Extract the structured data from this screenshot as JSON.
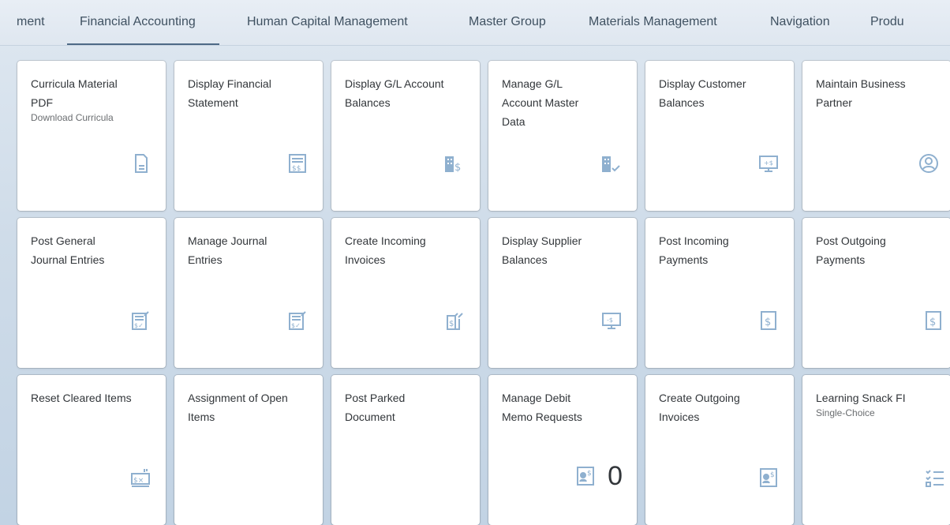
{
  "tabs": [
    {
      "label": "ment"
    },
    {
      "label": "Financial Accounting"
    },
    {
      "label": "Human Capital Management"
    },
    {
      "label": "Master Group"
    },
    {
      "label": "Materials Management"
    },
    {
      "label": "Navigation"
    },
    {
      "label": "Produ"
    }
  ],
  "active_tab": "Financial Accounting",
  "accent_color": "#4e6a86",
  "icon_color": "#8fb0cf",
  "tiles": [
    {
      "title": "Curricula Material\nPDF",
      "subtitle": "Download Curricula",
      "icon": "document-icon"
    },
    {
      "title": "Display Financial\nStatement",
      "icon": "financial-statement-icon"
    },
    {
      "title": "Display G/L Account\nBalances",
      "icon": "building-dollar-icon"
    },
    {
      "title": "Manage G/L\nAccount Master\nData",
      "icon": "building-check-icon"
    },
    {
      "title": "Display Customer\nBalances",
      "icon": "monitor-plus-dollar-icon"
    },
    {
      "title": "Maintain Business\nPartner",
      "icon": "person-circle-icon"
    },
    {
      "title": "Post General\nJournal Entries",
      "icon": "journal-edit-icon"
    },
    {
      "title": "Manage Journal\nEntries",
      "icon": "journal-edit-icon"
    },
    {
      "title": "Create Incoming\nInvoices",
      "icon": "invoice-edit-icon"
    },
    {
      "title": "Display Supplier\nBalances",
      "icon": "monitor-minus-dollar-icon"
    },
    {
      "title": "Post Incoming\nPayments",
      "icon": "dollar-box-icon"
    },
    {
      "title": "Post Outgoing\nPayments",
      "icon": "dollar-box-icon"
    },
    {
      "title": "Reset Cleared Items",
      "icon": "reset-cleared-icon"
    },
    {
      "title": "Assignment of Open\nItems",
      "icon": ""
    },
    {
      "title": "Post Parked\nDocument",
      "icon": ""
    },
    {
      "title": "Manage Debit\nMemo Requests",
      "icon": "debit-memo-icon",
      "kpi": "0"
    },
    {
      "title": "Create Outgoing\nInvoices",
      "icon": "debit-memo-icon"
    },
    {
      "title": "Learning Snack FI",
      "subtitle": "Single-Choice",
      "icon": "checklist-icon"
    }
  ]
}
